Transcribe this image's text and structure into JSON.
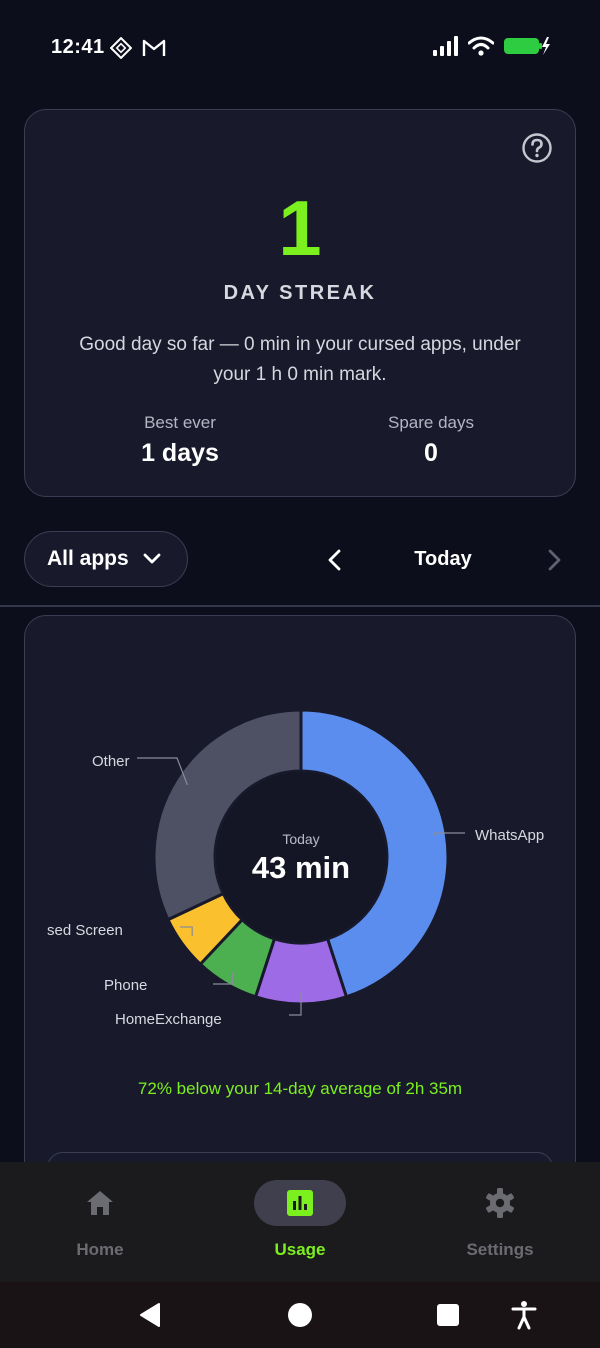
{
  "status_bar": {
    "time": "12:41",
    "left_icons": [
      "pattern-icon",
      "gmail-icon"
    ],
    "right_icons": [
      "signal-icon",
      "wifi-icon",
      "battery-charging-icon"
    ]
  },
  "streak": {
    "count": "1",
    "label": "DAY STREAK",
    "message": "Good day so far — 0 min in your cursed apps, under your 1 h 0 min mark.",
    "best_label": "Best ever",
    "best_value": "1 days",
    "spare_label": "Spare days",
    "spare_value": "0"
  },
  "filter": {
    "app_filter_label": "All apps",
    "date_label": "Today"
  },
  "usage": {
    "center_label": "Today",
    "center_value": "43 min",
    "average_text": "72% below your 14-day average of 2h 35m"
  },
  "chart_data": {
    "type": "pie",
    "categories": [
      "WhatsApp",
      "HomeExchange",
      "Phone",
      "sed Screen",
      "Other"
    ],
    "values": [
      45,
      10,
      7,
      6,
      32
    ],
    "colors": [
      "#5b8def",
      "#9d6be6",
      "#4caf50",
      "#fbc02d",
      "#4e5164"
    ]
  },
  "nav": {
    "items": [
      {
        "label": "Home",
        "icon": "home-icon"
      },
      {
        "label": "Usage",
        "icon": "bar-chart-icon"
      },
      {
        "label": "Settings",
        "icon": "gear-icon"
      }
    ]
  },
  "colors": {
    "accent": "#7cf01f",
    "background": "#0d0e1c",
    "card": "#181a2b",
    "card_border": "#3b3d52"
  }
}
